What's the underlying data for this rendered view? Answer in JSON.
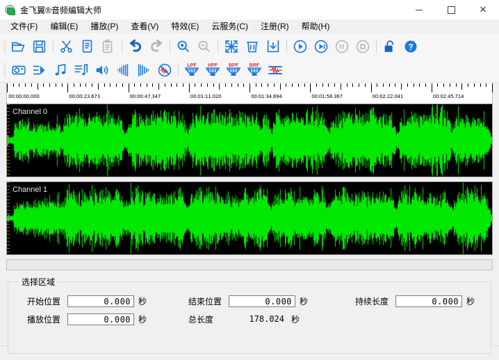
{
  "window": {
    "title": "金飞翼®音频编辑大师",
    "icon": "app-logo-icon",
    "controls": {
      "minimize": "—",
      "maximize": "□",
      "close": "✕"
    }
  },
  "menubar": {
    "items": [
      {
        "label": "文件(F)",
        "name": "menu-file"
      },
      {
        "label": "编辑(E)",
        "name": "menu-edit"
      },
      {
        "label": "播放(P)",
        "name": "menu-play"
      },
      {
        "label": "查看(V)",
        "name": "menu-view"
      },
      {
        "label": "特效(E)",
        "name": "menu-effects"
      },
      {
        "label": "云服务(C)",
        "name": "menu-cloud"
      },
      {
        "label": "注册(R)",
        "name": "menu-register"
      },
      {
        "label": "帮助(H)",
        "name": "menu-help"
      }
    ]
  },
  "toolbar_row1": {
    "icons": [
      "open-folder-icon",
      "save-icon",
      "cut-scissors-icon",
      "copy-icon",
      "paste-icon",
      "undo-arrow-icon",
      "redo-arrow-icon",
      "zoom-in-icon",
      "zoom-out-icon",
      "select-all-icon",
      "delete-trash-icon",
      "trim-download-icon",
      "play-icon",
      "play-selection-icon",
      "pause-icon",
      "stop-icon",
      "unlock-icon",
      "help-question-icon"
    ]
  },
  "toolbar_row2": {
    "icons": [
      "record-icon",
      "mix-icon",
      "music-note-icon",
      "music-list-icon",
      "volume-icon",
      "fade-in-icon",
      "fade-out-icon",
      "noise-reduction-icon",
      "lpf-filter-icon",
      "hpf-filter-icon",
      "bpf-filter-icon",
      "brf-filter-icon",
      "normalize-icon"
    ],
    "filter_labels": [
      "LPF",
      "HPF",
      "BPF",
      "BRF"
    ]
  },
  "ruler": {
    "labels": [
      "00:00:00.000",
      "00:00:23.673",
      "00:00:47.347",
      "00:01:11.020",
      "00:01:34.694",
      "00:01:58.367",
      "00:02:22.041",
      "00:02:45.714"
    ]
  },
  "waveform": {
    "channels": [
      {
        "label": "Channel 0",
        "name": "waveform-channel-0"
      },
      {
        "label": "Channel 1",
        "name": "waveform-channel-1"
      }
    ],
    "wave_color": "#00e800",
    "background_color": "#000000"
  },
  "selection": {
    "legend": "选择区域",
    "fields": [
      {
        "label": "开始位置",
        "value": "0.000",
        "unit": "秒",
        "name": "start-position"
      },
      {
        "label": "结束位置",
        "value": "0.000",
        "unit": "秒",
        "name": "end-position"
      },
      {
        "label": "持续长度",
        "value": "0.000",
        "unit": "秒",
        "name": "duration-length"
      },
      {
        "label": "播放位置",
        "value": "0.000",
        "unit": "秒",
        "name": "play-position"
      }
    ],
    "total": {
      "label": "总长度",
      "value": "178.024",
      "unit": "秒",
      "name": "total-length"
    }
  },
  "colors": {
    "accent": "#1a7ae0",
    "accent_dark": "#1565c0",
    "grey_icon": "#b8b8b8",
    "red": "#e03030"
  }
}
